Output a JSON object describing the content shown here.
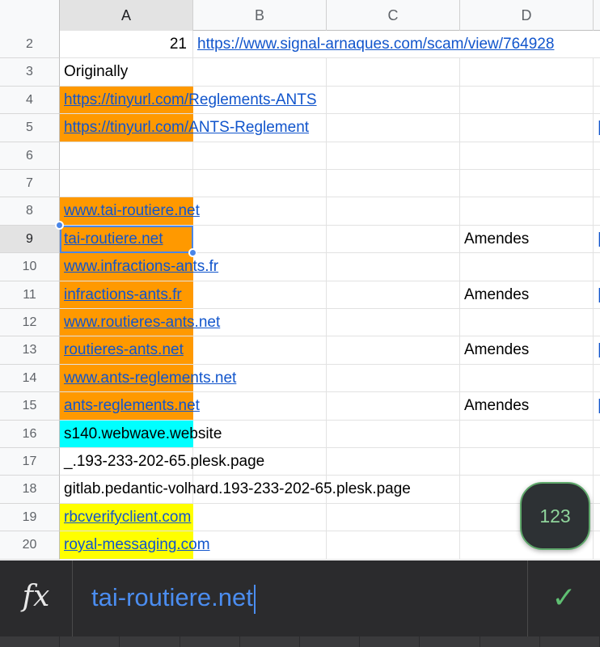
{
  "columns": [
    "A",
    "B",
    "C",
    "D"
  ],
  "selected_column": "A",
  "rows": [
    {
      "num": "2",
      "a": "21",
      "a_align": "right",
      "a_link": false,
      "a_fill": "",
      "b": "https://www.signal-arnaques.com/scam/view/764928",
      "b_link": true,
      "d": "",
      "e_link": false
    },
    {
      "num": "3",
      "a": "Originally",
      "a_link": false,
      "a_fill": "",
      "b": "",
      "d": "",
      "e_link": false
    },
    {
      "num": "4",
      "a": "https://tinyurl.com/Reglements-ANTS",
      "a_link": true,
      "a_fill": "#ff9900",
      "b": "",
      "d": "",
      "e_link": false
    },
    {
      "num": "5",
      "a": "https://tinyurl.com/ANTS-Reglement",
      "a_link": true,
      "a_fill": "#ff9900",
      "b": "",
      "d": "",
      "e_link": true
    },
    {
      "num": "6",
      "a": "",
      "a_link": false,
      "a_fill": "",
      "b": "",
      "d": "",
      "e_link": false
    },
    {
      "num": "7",
      "a": "",
      "a_link": false,
      "a_fill": "",
      "b": "",
      "d": "",
      "e_link": false
    },
    {
      "num": "8",
      "a": "www.tai-routiere.net",
      "a_link": true,
      "a_fill": "#ff9900",
      "b": "",
      "d": "",
      "e_link": false
    },
    {
      "num": "9",
      "a": "tai-routiere.net",
      "a_link": true,
      "a_fill": "#ff9900",
      "b": "",
      "d": "Amendes",
      "e_link": true
    },
    {
      "num": "10",
      "a": "www.infractions-ants.fr",
      "a_link": true,
      "a_fill": "#ff9900",
      "b": "",
      "d": "",
      "e_link": false
    },
    {
      "num": "11",
      "a": "infractions-ants.fr",
      "a_link": true,
      "a_fill": "#ff9900",
      "b": "",
      "d": "Amendes",
      "e_link": true
    },
    {
      "num": "12",
      "a": "www.routieres-ants.net",
      "a_link": true,
      "a_fill": "#ff9900",
      "b": "",
      "d": "",
      "e_link": false
    },
    {
      "num": "13",
      "a": "routieres-ants.net",
      "a_link": true,
      "a_fill": "#ff9900",
      "b": "",
      "d": "Amendes",
      "e_link": true
    },
    {
      "num": "14",
      "a": "www.ants-reglements.net",
      "a_link": true,
      "a_fill": "#ff9900",
      "b": "",
      "d": "",
      "e_link": false
    },
    {
      "num": "15",
      "a": "ants-reglements.net",
      "a_link": true,
      "a_fill": "#ff9900",
      "b": "",
      "d": "Amendes",
      "e_link": true
    },
    {
      "num": "16",
      "a": "s140.webwave.website",
      "a_link": false,
      "a_fill": "#00ffff",
      "b": "",
      "d": "",
      "e_link": false
    },
    {
      "num": "17",
      "a": "_.193-233-202-65.plesk.page",
      "a_link": false,
      "a_fill": "",
      "b": "",
      "d": "",
      "e_link": false
    },
    {
      "num": "18",
      "a": "gitlab.pedantic-volhard.193-233-202-65.plesk.page",
      "a_link": false,
      "a_fill": "",
      "b": "",
      "d": "",
      "e_link": false
    },
    {
      "num": "19",
      "a": "rbcverifyclient.com",
      "a_link": true,
      "a_fill": "#ffff00",
      "b": "",
      "d": "",
      "e_link": false
    },
    {
      "num": "20",
      "a": "royal-messaging.com",
      "a_link": true,
      "a_fill": "#ffff00",
      "b": "",
      "d": "",
      "e_link": false
    }
  ],
  "selected_cell_row": "9",
  "selected_cell_col": "A",
  "fab": {
    "label": "123"
  },
  "formula_bar": {
    "fx_label": "fx",
    "value": "tai-routiere.net",
    "confirm_icon": "check-icon"
  },
  "colors": {
    "link": "#1155cc",
    "selection": "#4a86e8",
    "orange_fill": "#ff9900",
    "cyan_fill": "#00ffff",
    "yellow_fill": "#ffff00",
    "formula_text": "#4b8df0",
    "confirm": "#5fbf72"
  }
}
